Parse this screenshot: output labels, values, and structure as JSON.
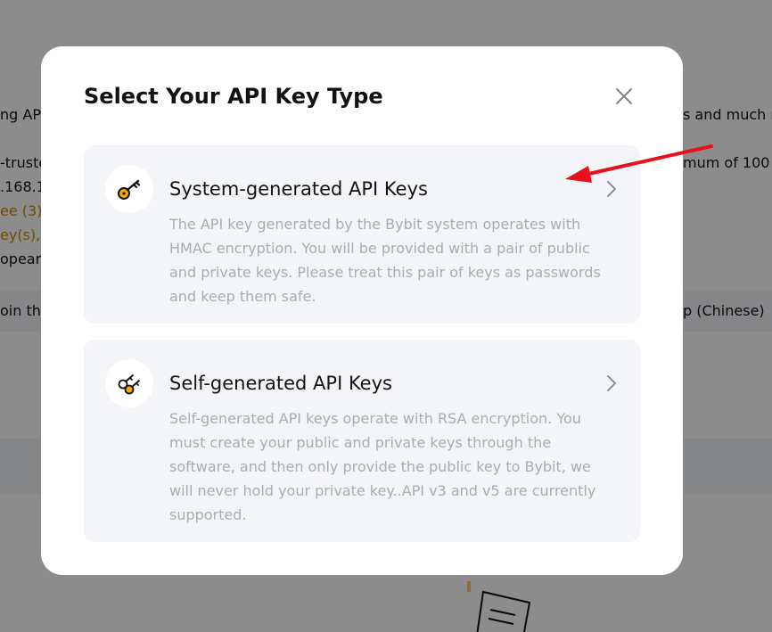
{
  "background": {
    "left_fragments": [
      "ng AP",
      "-truste",
      ".168.1",
      "ee (3)",
      "ey(s),",
      "opear c",
      "oin the"
    ],
    "right_fragments": [
      "s and much m",
      "mum of 100",
      "p (Chinese)"
    ]
  },
  "modal": {
    "title": "Select Your API Key Type",
    "options": [
      {
        "title": "System-generated API Keys",
        "description": "The API key generated by the Bybit system operates with HMAC encryption. You will be provided with a pair of public and private keys. Please treat this pair of keys as passwords and keep them safe.",
        "icon": "key-icon"
      },
      {
        "title": "Self-generated API Keys",
        "description": "Self-generated API keys operate with RSA encryption. You must create your public and private keys through the software, and then only provide the public key to Bybit, we will never hold your private key..API v3 and v5 are currently supported.",
        "icon": "keys-icon"
      }
    ]
  },
  "colors": {
    "accent": "#f7a600",
    "annotation": "#e8101b",
    "card_bg": "#f4f5f9",
    "muted_text": "#a9adb6"
  }
}
